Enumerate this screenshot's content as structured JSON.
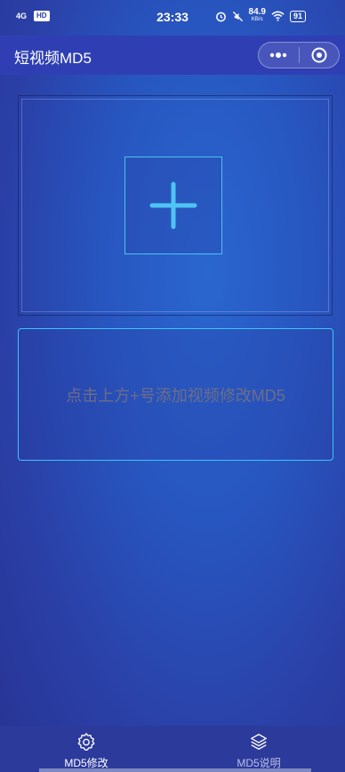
{
  "status_bar": {
    "signal": "4G",
    "hd": "HD",
    "time": "23:33",
    "speed_value": "84.9",
    "speed_unit": "KB/s",
    "battery": "91"
  },
  "nav": {
    "title": "短视频MD5",
    "more_icon": "more-dots-icon",
    "close_icon": "target-circle-icon"
  },
  "upload": {
    "icon": "plus-icon"
  },
  "hint": {
    "text": "点击上方+号添加视频修改MD5"
  },
  "tabs": [
    {
      "label": "MD5修改",
      "icon": "gear-icon",
      "active": true
    },
    {
      "label": "MD5说明",
      "icon": "layers-icon",
      "active": false
    }
  ],
  "colors": {
    "accent": "#3ec4f4",
    "tab_bar": "#2c3a9c",
    "nav_bar": "#2f3fb3",
    "hint_text": "#6d6d88"
  }
}
